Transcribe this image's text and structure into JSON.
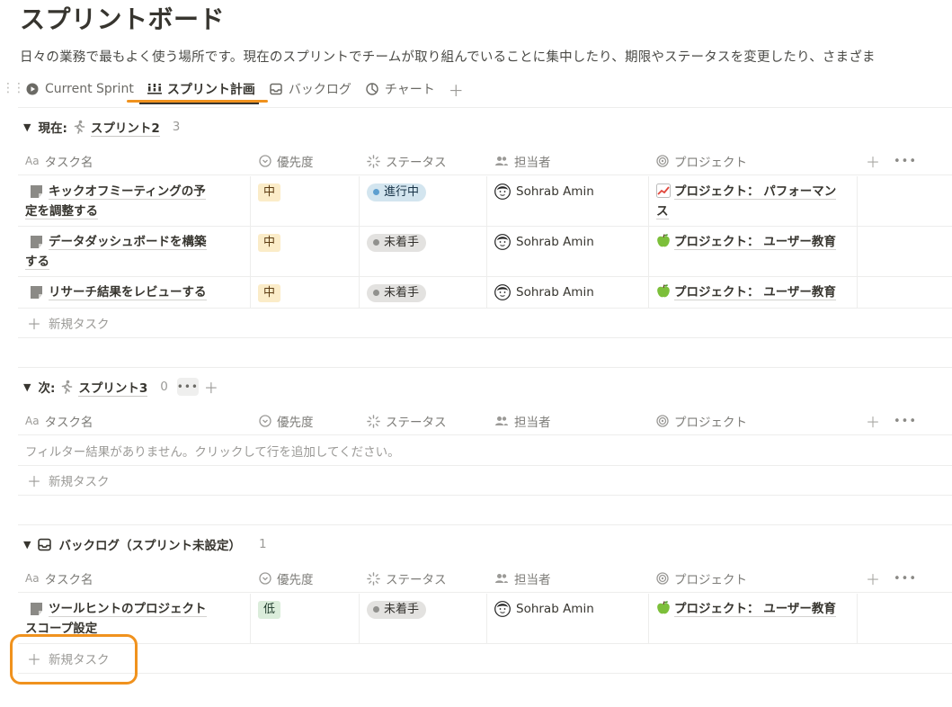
{
  "page": {
    "title": "スプリントボード",
    "description": "日々の業務で最もよく使う場所です。現在のスプリントでチームが取り組んでいることに集中したり、期限やステータスを変更したり、さまざま"
  },
  "tabs": [
    {
      "label": "Current Sprint",
      "icon": "play-circle-icon",
      "active": false
    },
    {
      "label": "スプリント計画",
      "icon": "board-icon",
      "active": true
    },
    {
      "label": "バックログ",
      "icon": "inbox-icon",
      "active": false
    },
    {
      "label": "チャート",
      "icon": "chart-icon",
      "active": false
    }
  ],
  "columns": {
    "name": "タスク名",
    "priority": "優先度",
    "status": "ステータス",
    "assignee": "担当者",
    "project": "プロジェクト"
  },
  "groups": {
    "current": {
      "label": "現在:",
      "sprint": "スプリント2",
      "count": "3",
      "rows": [
        {
          "name_line1": "キックオフミーティングの予",
          "name_line2": "定を調整する",
          "priority": "中",
          "status": "進行中",
          "assignee": "Sohrab Amin",
          "project_line1": "プロジェクト： パフォーマン",
          "project_line2": "ス",
          "project_emoji": "chart-up-emoji"
        },
        {
          "name_line1": "データダッシュボードを構築",
          "name_line2": "する",
          "priority": "中",
          "status": "未着手",
          "assignee": "Sohrab Amin",
          "project_line1": "プロジェクト： ユーザー教育",
          "project_line2": "",
          "project_emoji": "green-apple-emoji"
        },
        {
          "name_line1": "リサーチ結果をレビューする",
          "name_line2": "",
          "priority": "中",
          "status": "未着手",
          "assignee": "Sohrab Amin",
          "project_line1": "プロジェクト： ユーザー教育",
          "project_line2": "",
          "project_emoji": "green-apple-emoji"
        }
      ],
      "new_task": "新規タスク"
    },
    "next": {
      "label": "次:",
      "sprint": "スプリント3",
      "count": "0",
      "empty_message": "フィルター結果がありません。クリックして行を追加してください。",
      "new_task": "新規タスク"
    },
    "backlog": {
      "label": "バックログ（スプリント未設定）",
      "count": "1",
      "rows": [
        {
          "name_line1": "ツールヒントのプロジェクト",
          "name_line2": "スコープ設定",
          "priority": "低",
          "status": "未着手",
          "assignee": "Sohrab Amin",
          "project_line1": "プロジェクト： ユーザー教育",
          "project_line2": "",
          "project_emoji": "green-apple-emoji"
        }
      ],
      "new_task": "新規タスク"
    }
  },
  "colors": {
    "accent_highlight": "#f0921e",
    "priority_mid_bg": "#fbecc8",
    "priority_low_bg": "#dbeddb",
    "status_progress_bg": "#d3e5ef",
    "status_todo_bg": "#e3e2e0"
  }
}
